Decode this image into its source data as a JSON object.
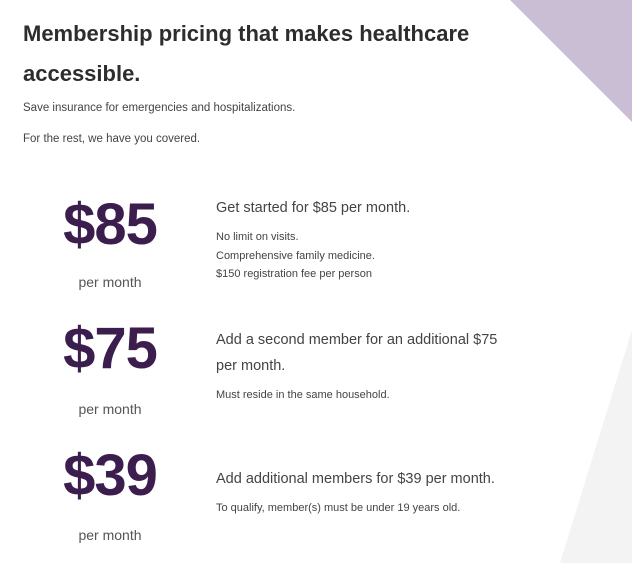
{
  "header": {
    "title": "Membership pricing that makes healthcare accessible.",
    "intro_line1": "Save insurance for emergencies and hospitalizations.",
    "intro_line2": "For the rest, we have you covered."
  },
  "tiers": [
    {
      "price": "$85",
      "period": "per month",
      "heading": "Get started for $85 per month.",
      "details": [
        "No limit on visits.",
        "Comprehensive family medicine.",
        "$150 registration fee per person"
      ]
    },
    {
      "price": "$75",
      "period": "per month",
      "heading": "Add a second member for an additional $75 per month.",
      "details": [
        "Must reside in the same household."
      ]
    },
    {
      "price": "$39",
      "period": "per month",
      "heading": "Add additional members for $39 per month.",
      "details": [
        "To qualify, member(s) must be under 19 years old."
      ]
    }
  ],
  "colors": {
    "price_text": "#3b1e4d",
    "corner_shape": "#c9bed3",
    "side_shape": "#f2f2f2"
  }
}
